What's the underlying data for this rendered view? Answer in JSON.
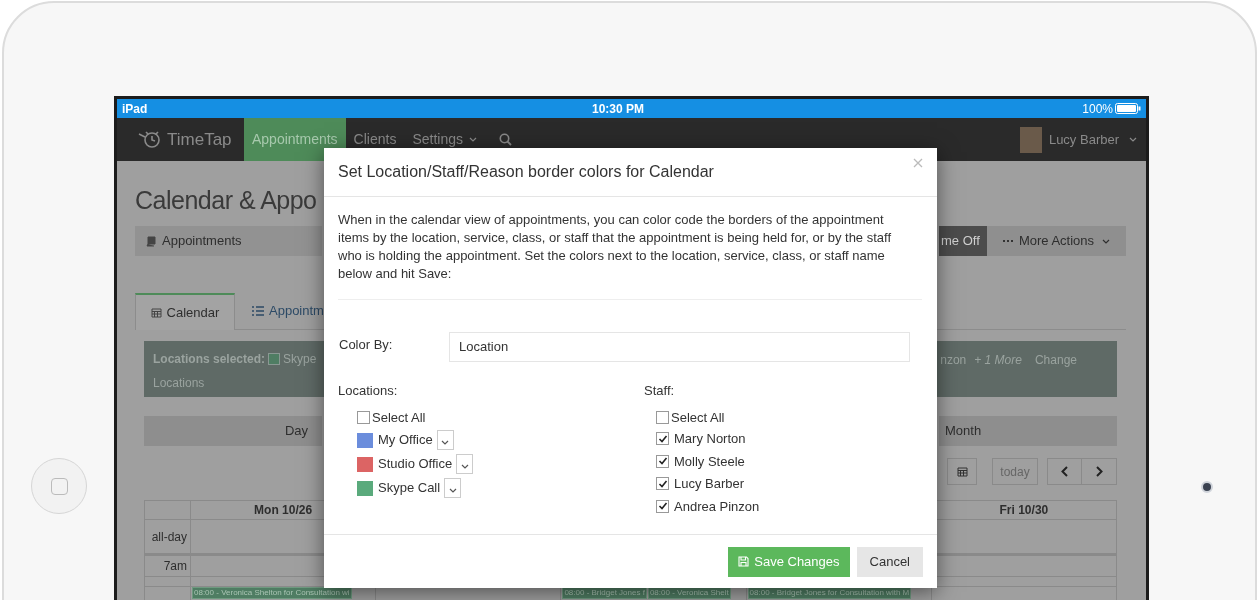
{
  "status_bar": {
    "device": "iPad",
    "time": "10:30 PM",
    "battery": "100%"
  },
  "navbar": {
    "logo": "TimeTap",
    "items": [
      {
        "label": "Appointments",
        "selected": true,
        "dropdown": false
      },
      {
        "label": "Clients",
        "selected": false,
        "dropdown": false
      },
      {
        "label": "Settings",
        "selected": false,
        "dropdown": true
      }
    ],
    "user": "Lucy Barber"
  },
  "page": {
    "heading": "Calendar & Appo",
    "subnav": "Appointments",
    "actions": [
      {
        "label": "me Off",
        "kind": "dark"
      },
      {
        "label": "More Actions",
        "kind": "menu"
      }
    ],
    "tabs": [
      {
        "label": "Calendar",
        "selected": true
      },
      {
        "label": "Appointm",
        "selected": false
      }
    ],
    "filter": {
      "label": "Locations selected:",
      "first": "Skype",
      "second_line": "Locations",
      "tail": "nzon",
      "more": "+ 1 More",
      "link": "Change"
    },
    "views": [
      "Day",
      "Month"
    ],
    "today": "today",
    "calendar": {
      "rows": [
        "all-day",
        "7am"
      ],
      "columns": [
        {
          "header": "Mon 10/26",
          "events": [
            "08:00 - Veronica Shelton for Consultation wi"
          ]
        },
        {},
        {
          "events": [
            "08:00 - Bridget Jones f",
            "08:00 - Veronica Shelt"
          ]
        },
        {
          "events": [
            "08:00 - Bridget Jones for Consultation with M"
          ]
        },
        {
          "header": "Fri 10/30"
        }
      ]
    }
  },
  "modal": {
    "title": "Set Location/Staff/Reason border colors for Calendar",
    "description": "When in the calendar view of appointments, you can color code the borders of the appointment items by the location, service, class, or staff that the appointment is being held for, or by the staff who is holding the appointment. Set the colors next to the location, service, class, or staff name below and hit Save:",
    "color_by": {
      "label": "Color By:",
      "value": "Location"
    },
    "locations": {
      "label": "Locations:",
      "select_all": {
        "label": "Select All",
        "checked": false
      },
      "items": [
        {
          "name": "My Office",
          "color": "#6b8ddc"
        },
        {
          "name": "Studio Office",
          "color": "#dc6464"
        },
        {
          "name": "Skype Call",
          "color": "#5aaa7c"
        }
      ]
    },
    "staff": {
      "label": "Staff:",
      "select_all": {
        "label": "Select All",
        "checked": false
      },
      "items": [
        {
          "name": "Mary Norton",
          "checked": true
        },
        {
          "name": "Molly Steele",
          "checked": true
        },
        {
          "name": "Lucy Barber",
          "checked": true
        },
        {
          "name": "Andrea Pinzon",
          "checked": true
        }
      ]
    },
    "buttons": [
      {
        "label": "Save Changes",
        "kind": "primary"
      },
      {
        "label": "Cancel",
        "kind": "default"
      }
    ]
  }
}
